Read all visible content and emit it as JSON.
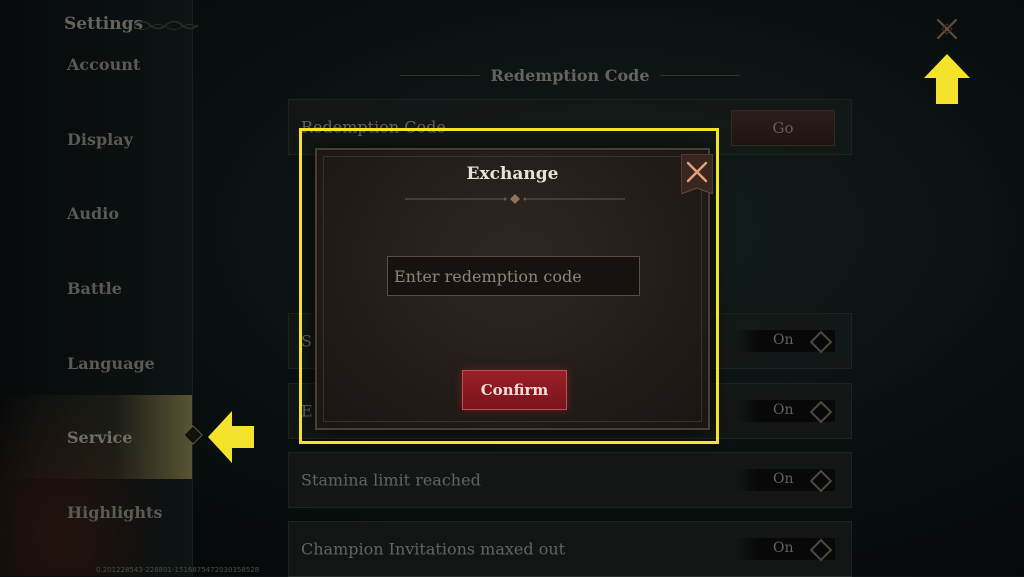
{
  "header": {
    "title": "Settings"
  },
  "sidebar": {
    "items": [
      {
        "label": "Account"
      },
      {
        "label": "Display"
      },
      {
        "label": "Audio"
      },
      {
        "label": "Battle"
      },
      {
        "label": "Language"
      },
      {
        "label": "Service",
        "active": true
      },
      {
        "label": "Highlights"
      }
    ]
  },
  "version_text": "0.201228543-228801-1516875472030358528",
  "main": {
    "section_title": "Redemption Code",
    "redemption_row": {
      "label": "Redemption Code",
      "button_label": "Go"
    },
    "rows": [
      {
        "label": "S",
        "toggle": "On"
      },
      {
        "label": "E",
        "toggle": "On"
      },
      {
        "label": "Stamina limit reached",
        "toggle": "On"
      },
      {
        "label": "Champion Invitations maxed out",
        "toggle": "On"
      }
    ]
  },
  "modal": {
    "title": "Exchange",
    "input_placeholder": "Enter redemption code",
    "input_value": "",
    "confirm_label": "Confirm"
  },
  "icons": {
    "close": "close-x-icon",
    "arrow": "arrow-icon",
    "diamond": "diamond-icon"
  },
  "colors": {
    "highlight": "#f4e32a",
    "confirm": "#8e1a22",
    "background": "#0d1414"
  }
}
